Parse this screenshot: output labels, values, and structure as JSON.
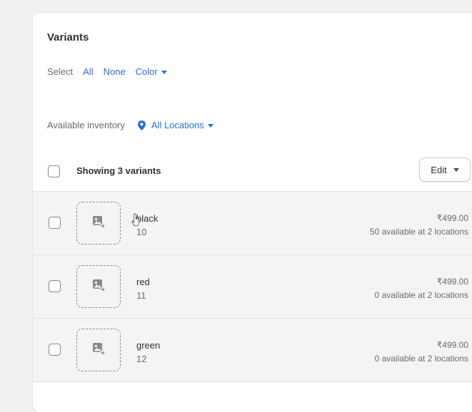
{
  "card": {
    "title": "Variants"
  },
  "select": {
    "label": "Select",
    "all": "All",
    "none": "None",
    "color": "Color"
  },
  "inventory": {
    "label": "Available inventory",
    "locations": "All Locations",
    "icon": "location-pin-icon"
  },
  "list_header": {
    "showing": "Showing 3 variants",
    "edit": "Edit"
  },
  "variants": [
    {
      "name": "black",
      "sku": "10",
      "price": "₹499.00",
      "availability": "50 available at 2 locations"
    },
    {
      "name": "red",
      "sku": "11",
      "price": "₹499.00",
      "availability": "0 available at 2 locations"
    },
    {
      "name": "green",
      "sku": "12",
      "price": "₹499.00",
      "availability": "0 available at 2 locations"
    }
  ],
  "colors": {
    "link": "#2c6ecb",
    "row_background": "#f4f4f4",
    "text": "#303030",
    "muted": "#6b6b6b"
  }
}
